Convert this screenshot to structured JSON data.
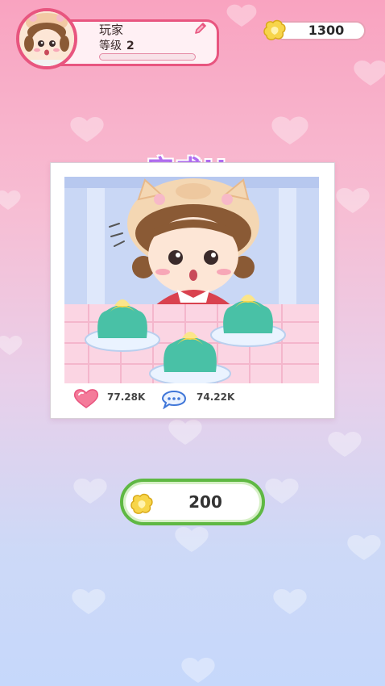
{
  "player": {
    "name": "玩家",
    "level_label": "等级",
    "level_value": "2",
    "level_progress": 0
  },
  "currency": {
    "coins": "1300"
  },
  "result": {
    "title": "完成!!",
    "likes": "77.28K",
    "comments": "74.22K"
  },
  "reward": {
    "amount": "200"
  },
  "colors": {
    "accent_pink": "#e8557f",
    "title_purple": "#b06ef0",
    "reward_green": "#5fb843",
    "jelly_teal": "#49c1a6"
  }
}
